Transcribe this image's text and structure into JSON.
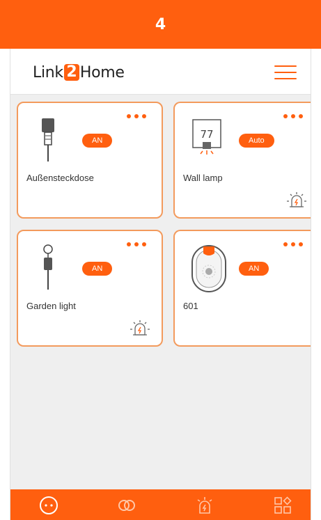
{
  "step_number": "4",
  "header": {
    "logo_left": "Link",
    "logo_num": "2",
    "logo_right": "Home",
    "menu_icon": "hamburger-menu-icon"
  },
  "devices": [
    {
      "name": "Außensteckdose",
      "state": "AN",
      "icon": "outdoor-socket-icon"
    },
    {
      "name": "Wall lamp",
      "state": "Auto",
      "icon": "wall-lamp-icon",
      "icon_text": "77",
      "alarm_icon": "alarm-light-icon"
    },
    {
      "name": "Garden light",
      "state": "AN",
      "icon": "garden-light-icon",
      "alarm_icon": "alarm-light-icon"
    },
    {
      "name": "601",
      "state": "AN",
      "icon": "sensor-device-icon"
    }
  ],
  "bottom_nav": {
    "items": [
      "home-dots-icon",
      "link-rings-icon",
      "alarm-light-icon",
      "apps-grid-icon"
    ],
    "active_index": 0
  },
  "colors": {
    "accent": "#ff5f0f",
    "card_border": "#f39a5c",
    "background": "#efefef"
  }
}
